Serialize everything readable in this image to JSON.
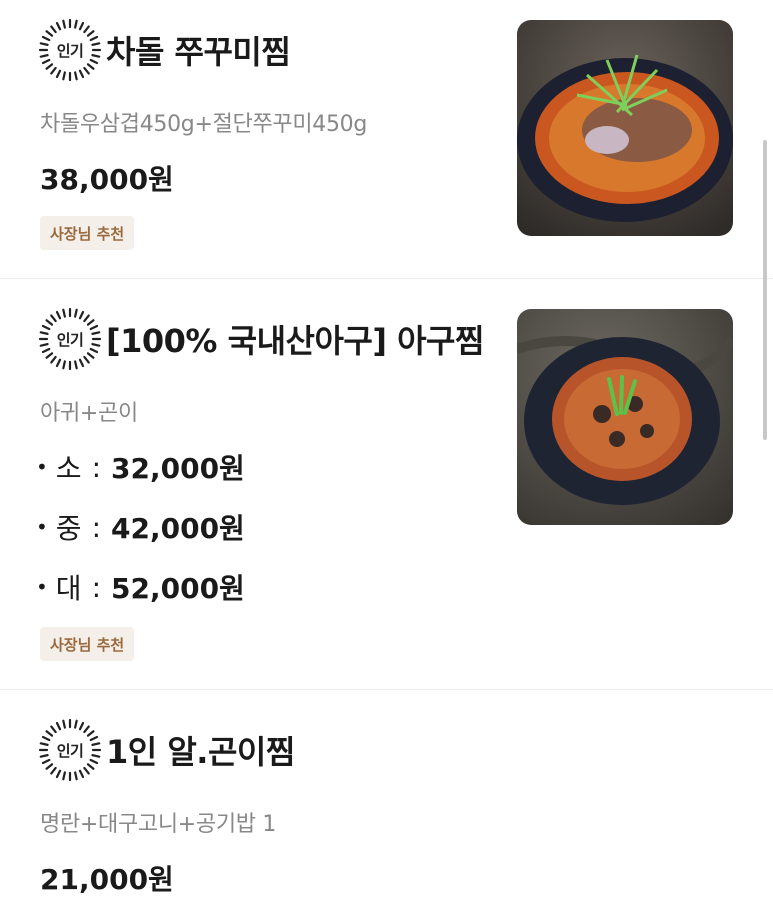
{
  "items": [
    {
      "badge": "인기",
      "title": "차돌 쭈꾸미찜",
      "description": "차돌우삼겹450g+절단쭈꾸미450g",
      "price": "38,000원",
      "tag": "사장님 추천",
      "image_icon": "dish-photo"
    },
    {
      "badge": "인기",
      "title": "[100% 국내산아구] 아구찜",
      "description": "아귀+곤이",
      "sizes": [
        {
          "name": "소",
          "price": "32,000원"
        },
        {
          "name": "중",
          "price": "42,000원"
        },
        {
          "name": "대",
          "price": "52,000원"
        }
      ],
      "tag": "사장님 추천",
      "image_icon": "dish-photo"
    },
    {
      "badge": "인기",
      "title": "1인 알.곤이찜",
      "description": "명란+대구고니+공기밥 1",
      "price": "21,000원"
    }
  ],
  "symbols": {
    "bullet": "•",
    "colon": ":"
  },
  "colors": {
    "tag_bg": "#f4efe9",
    "tag_text": "#9a6a3e",
    "desc": "#888888"
  }
}
